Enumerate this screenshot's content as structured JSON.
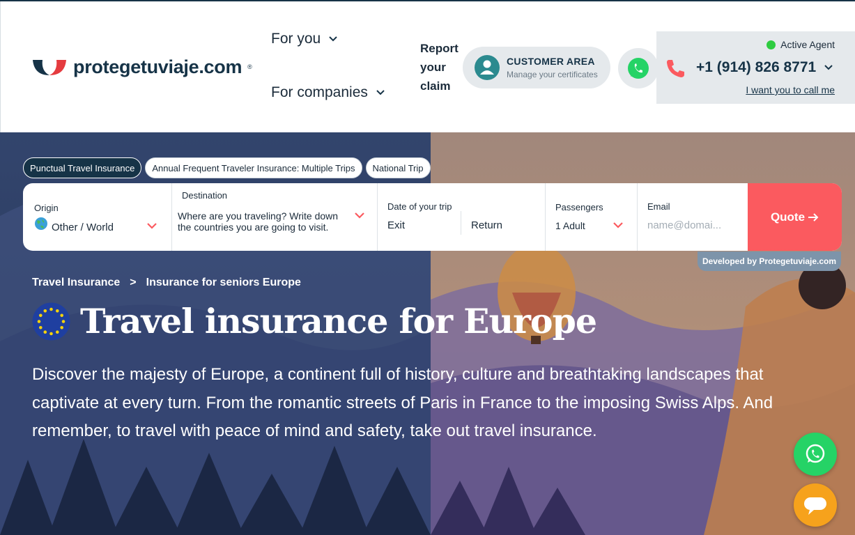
{
  "brand": {
    "logo_text": "protegetuviaje.com",
    "reg": "®"
  },
  "nav": {
    "for_you": "For you",
    "for_companies": "For companies",
    "report_claim": "Report your claim"
  },
  "customer_area": {
    "title": "CUSTOMER AREA",
    "subtitle": "Manage your certificates"
  },
  "agent": {
    "status": "Active Agent",
    "phone": "+1 (914) 826 8771",
    "call_me": "I want you to call me"
  },
  "tabs": [
    "Punctual Travel Insurance",
    "Annual Frequent Traveler Insurance: Multiple Trips",
    "National Trip"
  ],
  "search": {
    "origin_label": "Origin",
    "origin_value": "Other / World",
    "destination_label": "Destination",
    "destination_value": "Where are you traveling? Write down the countries you are going to visit.",
    "date_label": "Date of your trip",
    "exit": "Exit",
    "return": "Return",
    "passengers_label": "Passengers",
    "passengers_value": "1 Adult",
    "email_label": "Email",
    "email_placeholder": "name@domai...",
    "quote": "Quote"
  },
  "developed_by": "Developed by Protegetuviaje.com",
  "breadcrumb": {
    "root": "Travel Insurance",
    "separator": ">",
    "current": "Insurance for seniors Europe"
  },
  "hero": {
    "title": "Travel insurance for Europe",
    "description": "Discover the majesty of Europe, a continent full of history, culture and breathtaking landscapes that captivate at every turn. From the romantic streets of Paris in France to the imposing Swiss Alps. And remember, to travel with peace of mind and safety, take out travel insurance."
  },
  "colors": {
    "navy": "#163347",
    "accent_red": "#fb5a5f",
    "whatsapp": "#25d366",
    "chat": "#f6a21c",
    "agent_bg": "#e5e9ec"
  }
}
